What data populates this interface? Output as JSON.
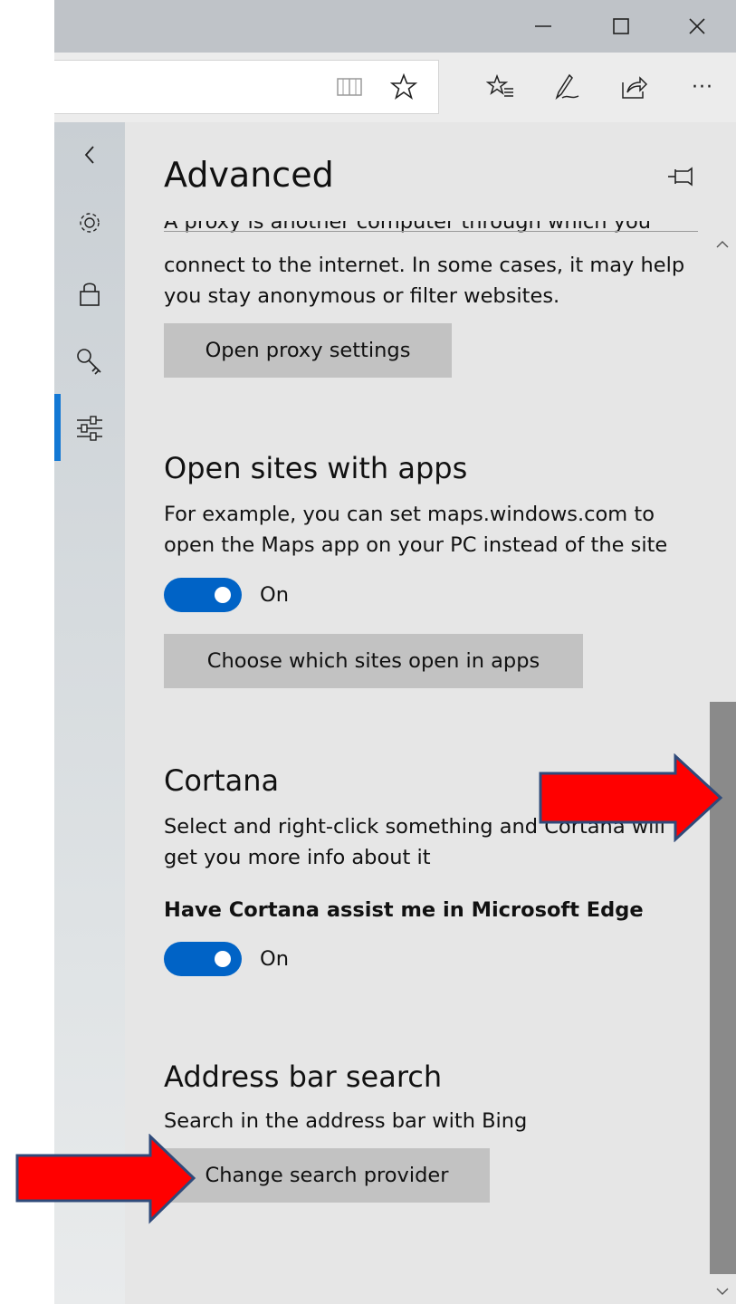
{
  "window": {
    "minimize_glyph": "—",
    "maximize_glyph": "☐",
    "close_glyph": "✕"
  },
  "toolbar": {
    "reading_view_icon": "reading-view-icon",
    "favorite_icon": "star-icon",
    "hub_icon": "favorites-hub-icon",
    "notes_icon": "web-note-icon",
    "share_icon": "share-icon",
    "more_label": "···"
  },
  "rail": {
    "back_icon": "chevron-left-icon",
    "items": [
      "gear-icon",
      "lock-icon",
      "key-icon",
      "sliders-icon"
    ],
    "active_index": 3
  },
  "panel": {
    "title": "Advanced",
    "pin_icon": "pin-icon",
    "proxy": {
      "text_line_cut": "A proxy is another computer through which you",
      "text_line1": "connect to the internet. In some cases, it may help",
      "text_line2": "you stay anonymous or filter websites.",
      "button": "Open proxy settings"
    },
    "open_sites": {
      "title": "Open sites with apps",
      "line1": "For example, you can set maps.windows.com to",
      "line2": "open the Maps app on your PC instead of the site",
      "toggle_label": "On",
      "toggle_on": true,
      "button": "Choose which sites open in apps"
    },
    "cortana": {
      "title": "Cortana",
      "line1": "Select and right-click something and Cortana will",
      "line2": "get you more info about it",
      "option_label": "Have Cortana assist me in Microsoft Edge",
      "toggle_label": "On",
      "toggle_on": true
    },
    "address_bar": {
      "title": "Address bar search",
      "line1": "Search in the address bar with Bing",
      "button": "Change search provider"
    }
  },
  "colors": {
    "accent": "#0063c6",
    "annotation_arrow": "#ff0000",
    "arrow_outline": "#2f4a7a"
  }
}
